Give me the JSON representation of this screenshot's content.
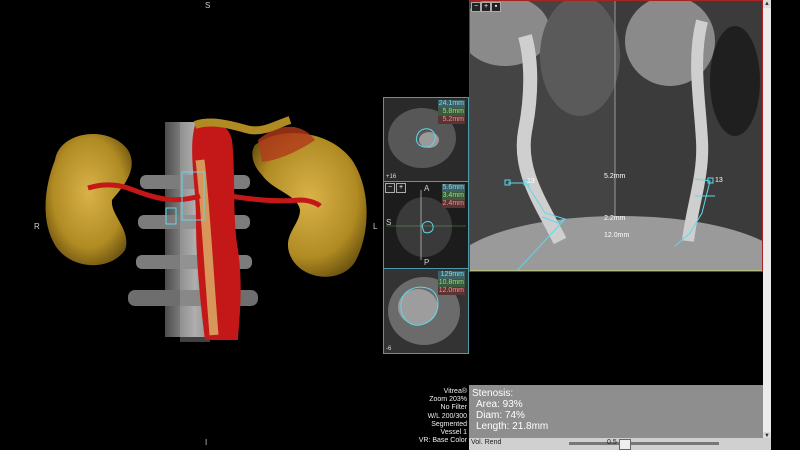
{
  "vr_view": {
    "orient_top": "S",
    "orient_left": "R",
    "orient_right": "L",
    "orient_bottom": "I"
  },
  "thumb1": {
    "measure1": "24.1mm",
    "measure2": "5.8mm",
    "measure3": "5.2mm",
    "corner": "+16"
  },
  "thumb2": {
    "orient_top": "A",
    "orient_left": "S",
    "orient_bottom": "P",
    "measure1": "5.6mm",
    "measure2": "3.4mm",
    "measure3": "2.4mm",
    "btn_minus": "−",
    "btn_plus": "+"
  },
  "thumb3": {
    "measure1": "129mm",
    "measure2": "10.8mm",
    "measure3": "12.0mm",
    "corner": "-6"
  },
  "cpr": {
    "btn_minus": "−",
    "btn_plus": "+",
    "btn_three": "▪",
    "label_13a": "13",
    "label_13b": "13",
    "meas_52": "5.2mm",
    "meas_22": "2.2mm",
    "meas_120": "12.0mm"
  },
  "info": {
    "lines": [
      "Vitrea®",
      "Zoom 203%",
      "No Filter",
      "W/L 200/300",
      "Segmented",
      "Vessel 1",
      "VR: Base Color"
    ]
  },
  "stenosis": {
    "title": "Stenosis:",
    "area": "Area: 93%",
    "diam": "Diam: 74%",
    "length": "Length: 21.8mm"
  },
  "bottom": {
    "slider_label": "Vol. Rend",
    "slider_value": "0.5"
  }
}
